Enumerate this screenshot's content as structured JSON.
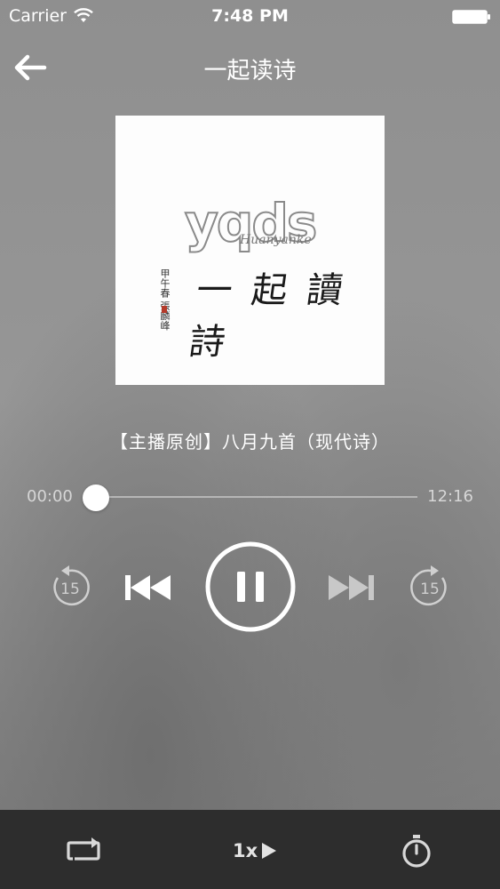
{
  "status_bar": {
    "carrier": "Carrier",
    "time": "7:48 PM"
  },
  "nav": {
    "title": "一起读诗",
    "back_icon": "back-arrow-icon"
  },
  "album": {
    "logo_text": "yqds",
    "logo_subtext": "Huanyanke",
    "calligraphy": "一起讀詩",
    "signature": "甲午春 張麟峰"
  },
  "track": {
    "title": "【主播原创】八月九首（现代诗）"
  },
  "progress": {
    "elapsed": "00:00",
    "total": "12:16",
    "fraction": 0.0
  },
  "controls": {
    "rewind_label": "15",
    "forward_label": "15",
    "state": "playing"
  },
  "bottom_bar": {
    "speed_label": "1x",
    "loop_icon": "repeat-icon",
    "timer_icon": "timer-icon"
  },
  "colors": {
    "bottom_bar_bg": "#2d2d2d",
    "screen_bg": "#8f8f8f",
    "accent": "#ffffff"
  }
}
